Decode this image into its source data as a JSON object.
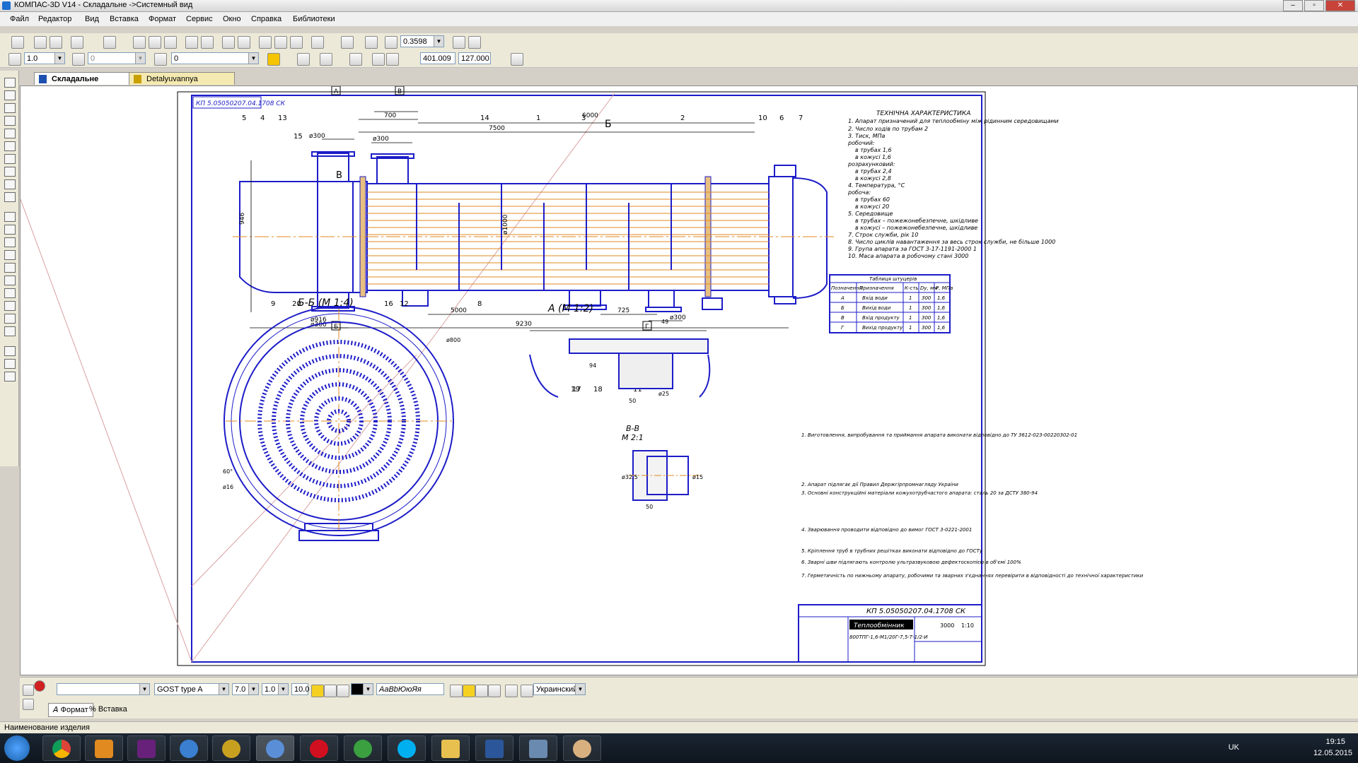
{
  "window": {
    "title": "КОМПАС-3D V14 - Складальне ->Системный вид"
  },
  "menu": [
    "Файл",
    "Редактор",
    "Вид",
    "Вставка",
    "Формат",
    "Сервис",
    "Окно",
    "Справка",
    "Библиотеки"
  ],
  "toolbar1": {
    "zoom_value": "0.3598"
  },
  "toolbar2": {
    "step_value": "1.0",
    "angle_value": "0",
    "layer_value": "0",
    "coord_x": "401.009",
    "coord_y": "127.000"
  },
  "tabs": [
    {
      "label": "Складальне",
      "active": true
    },
    {
      "label": "Detalyuvannya",
      "active": false
    }
  ],
  "drawing": {
    "stamp_rotated": "КП 5.05050207.04.1708 СК",
    "section_bb": "Б-Б (М 1:4)",
    "section_a": "А (М 1:2)",
    "section_vv_title": "В-В",
    "section_vv_scale": "М 2:1",
    "dims": [
      "700",
      "7500",
      "6000",
      "5000",
      "725",
      "9230",
      "ø300",
      "ø300",
      "ø300",
      "ø300",
      "ø300",
      "946",
      "ø1000",
      "ø916",
      "ø800",
      "60°",
      "ø16",
      "50",
      "49",
      "94",
      "50",
      "ø25",
      "ø15",
      "ø32,5"
    ],
    "callouts": [
      "1",
      "2",
      "3",
      "4",
      "5",
      "6",
      "7",
      "8",
      "9",
      "10",
      "11",
      "12",
      "13",
      "14",
      "15",
      "16",
      "17",
      "18",
      "19",
      "20"
    ],
    "markers": [
      "А",
      "Б",
      "В",
      "Г",
      "Б",
      "В"
    ],
    "tech_char_title": "ТЕХНІЧНА ХАРАКТЕРИСТИКА",
    "tech_char_lines": [
      "1. Апарат призначений для теплообміну між рідинним середовищами",
      "2. Число ходів по трубам  2",
      "3. Тиск, МПа",
      "робочий:",
      "в трубах  1,6",
      "в кожусі  1,6",
      "розрахунковий:",
      "в трубах  2,4",
      "в кожусі  2,8",
      "4. Температура, °С",
      "робоча:",
      "в трубах  60",
      "в кожусі  20",
      "5. Середовище",
      "в трубах – пожежонебезпечне, шкідливе",
      "в кожусі – пожежонебезпечне, шкідливе",
      "7. Строк служби, рік  10",
      "8. Число циклів навантаження за весь строк служби, не більше  1000",
      "9. Група апарата за ГОСТ 3-17-1191-2000  1",
      "10. Маса апарата в робочому стані  3000"
    ],
    "nozzle_table": {
      "title": "Таблиця штуцерів",
      "headers": [
        "Позначення",
        "Призначення",
        "К-сть",
        "Dу, мм",
        "Р, МПа"
      ],
      "rows": [
        [
          "А",
          "Вхід води",
          "1",
          "300",
          "1,6"
        ],
        [
          "Б",
          "Вихід води",
          "1",
          "300",
          "1,6"
        ],
        [
          "В",
          "Вхід продукту",
          "1",
          "300",
          "1,6"
        ],
        [
          "Г",
          "Вихід продукту",
          "1",
          "300",
          "1,6"
        ]
      ]
    },
    "notes": [
      "1. Виготовлення, випробування та приймання апарата виконати відповідно до ТУ 3612-023-00220302-01",
      "2. Апарат підлягає дії Правил Держгірпромнагляду України",
      "3. Основні конструкційні матеріали кожухотрубчастого апарата: сталь 20 за ДСТУ 380-94",
      "4. Зварювання проводити відповідно до вимог ГОСТ 3-0221-2001",
      "5. Кріплення труб в трубних решітках виконати відповідно до ГОСТу",
      "6. Зварні шви підлягають контролю ультразвуковою дефектоскопією в об'ємі 100%",
      "7. Герметичність по нижньому апарату, робочими та зварних з'єднаннях перевірити в відповідності до технічної характеристики"
    ],
    "title_block": {
      "code": "КП 5.05050207.04.1708 СК",
      "name": "Теплообмінник",
      "designation": "800ТПГ-1,6-М1/20Г-7,5-Т-1/2-И",
      "sheet": "3000",
      "scale": "1:10"
    }
  },
  "format_panel": {
    "style_value": "",
    "font": "GOST type A",
    "size": "7.0",
    "spacing": "1.0",
    "width": "10.0",
    "sample": "АаВbЮюЯя",
    "language": "Украинский",
    "tab_format": "Формат",
    "tab_insert": "Вставка"
  },
  "status": {
    "text": "Наименование изделия"
  },
  "taskbar": {
    "lang": "UK",
    "time": "19:15",
    "date": "12.05.2015"
  }
}
